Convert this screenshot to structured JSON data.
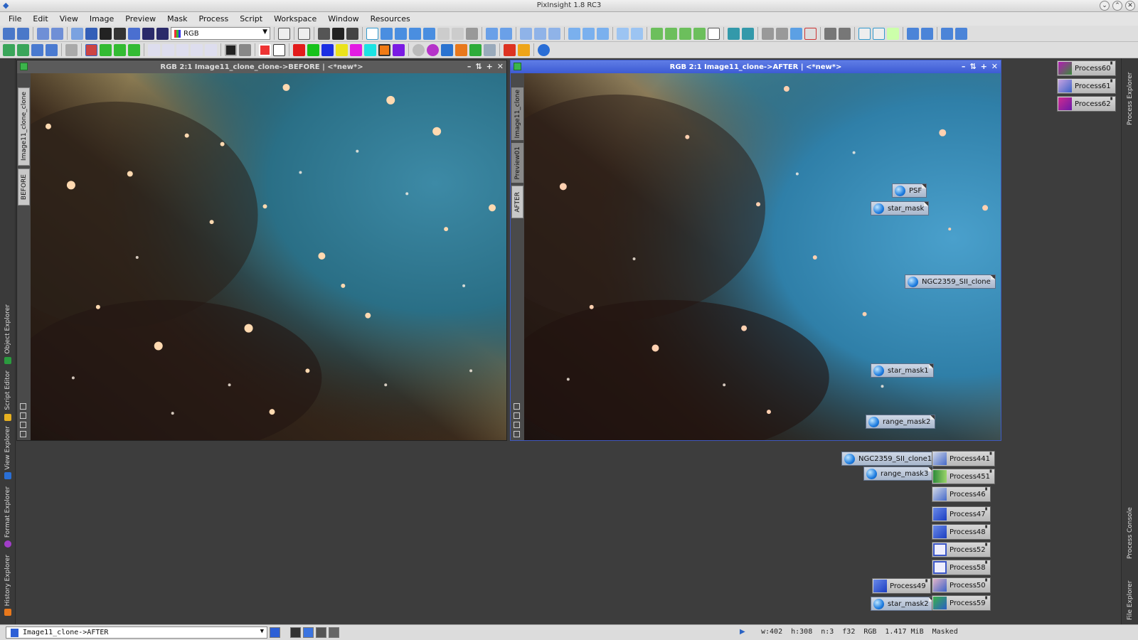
{
  "window": {
    "title": "PixInsight 1.8 RC3"
  },
  "menu": [
    "File",
    "Edit",
    "View",
    "Image",
    "Preview",
    "Mask",
    "Process",
    "Script",
    "Workspace",
    "Window",
    "Resources"
  ],
  "toolbar": {
    "color_space": "RGB"
  },
  "left_panels": [
    "Object Explorer",
    "Script Editor",
    "View Explorer",
    "Format Explorer",
    "History Explorer"
  ],
  "right_panels": [
    "Process Explorer",
    "Process Console",
    "File Explorer"
  ],
  "windows": {
    "before": {
      "title": "RGB 2:1 Image11_clone_clone->BEFORE | <*new*>",
      "tabs": [
        "Image11_clone_clone",
        "BEFORE"
      ]
    },
    "after": {
      "title": "RGB 2:1 Image11_clone->AFTER | <*new*>",
      "tabs": [
        "Image11_clone",
        "Preview01",
        "AFTER"
      ]
    }
  },
  "image_icons": [
    "PSF",
    "star_mask",
    "NGC2359_SII_clone",
    "star_mask1",
    "range_mask2",
    "NGC2359_SII_clone1",
    "range_mask3",
    "star_mask2"
  ],
  "process_icons": [
    "Process60",
    "Process61",
    "Process62",
    "Process441",
    "Process451",
    "Process46",
    "Process47",
    "Process48",
    "Process52",
    "Process58",
    "Process49",
    "Process50",
    "Process59"
  ],
  "status": {
    "view": "Image11_clone->AFTER",
    "width": "w:402",
    "height": "h:308",
    "channels": "n:3",
    "format": "f32",
    "space": "RGB",
    "size": "1.417 MiB",
    "mask": "Masked"
  }
}
